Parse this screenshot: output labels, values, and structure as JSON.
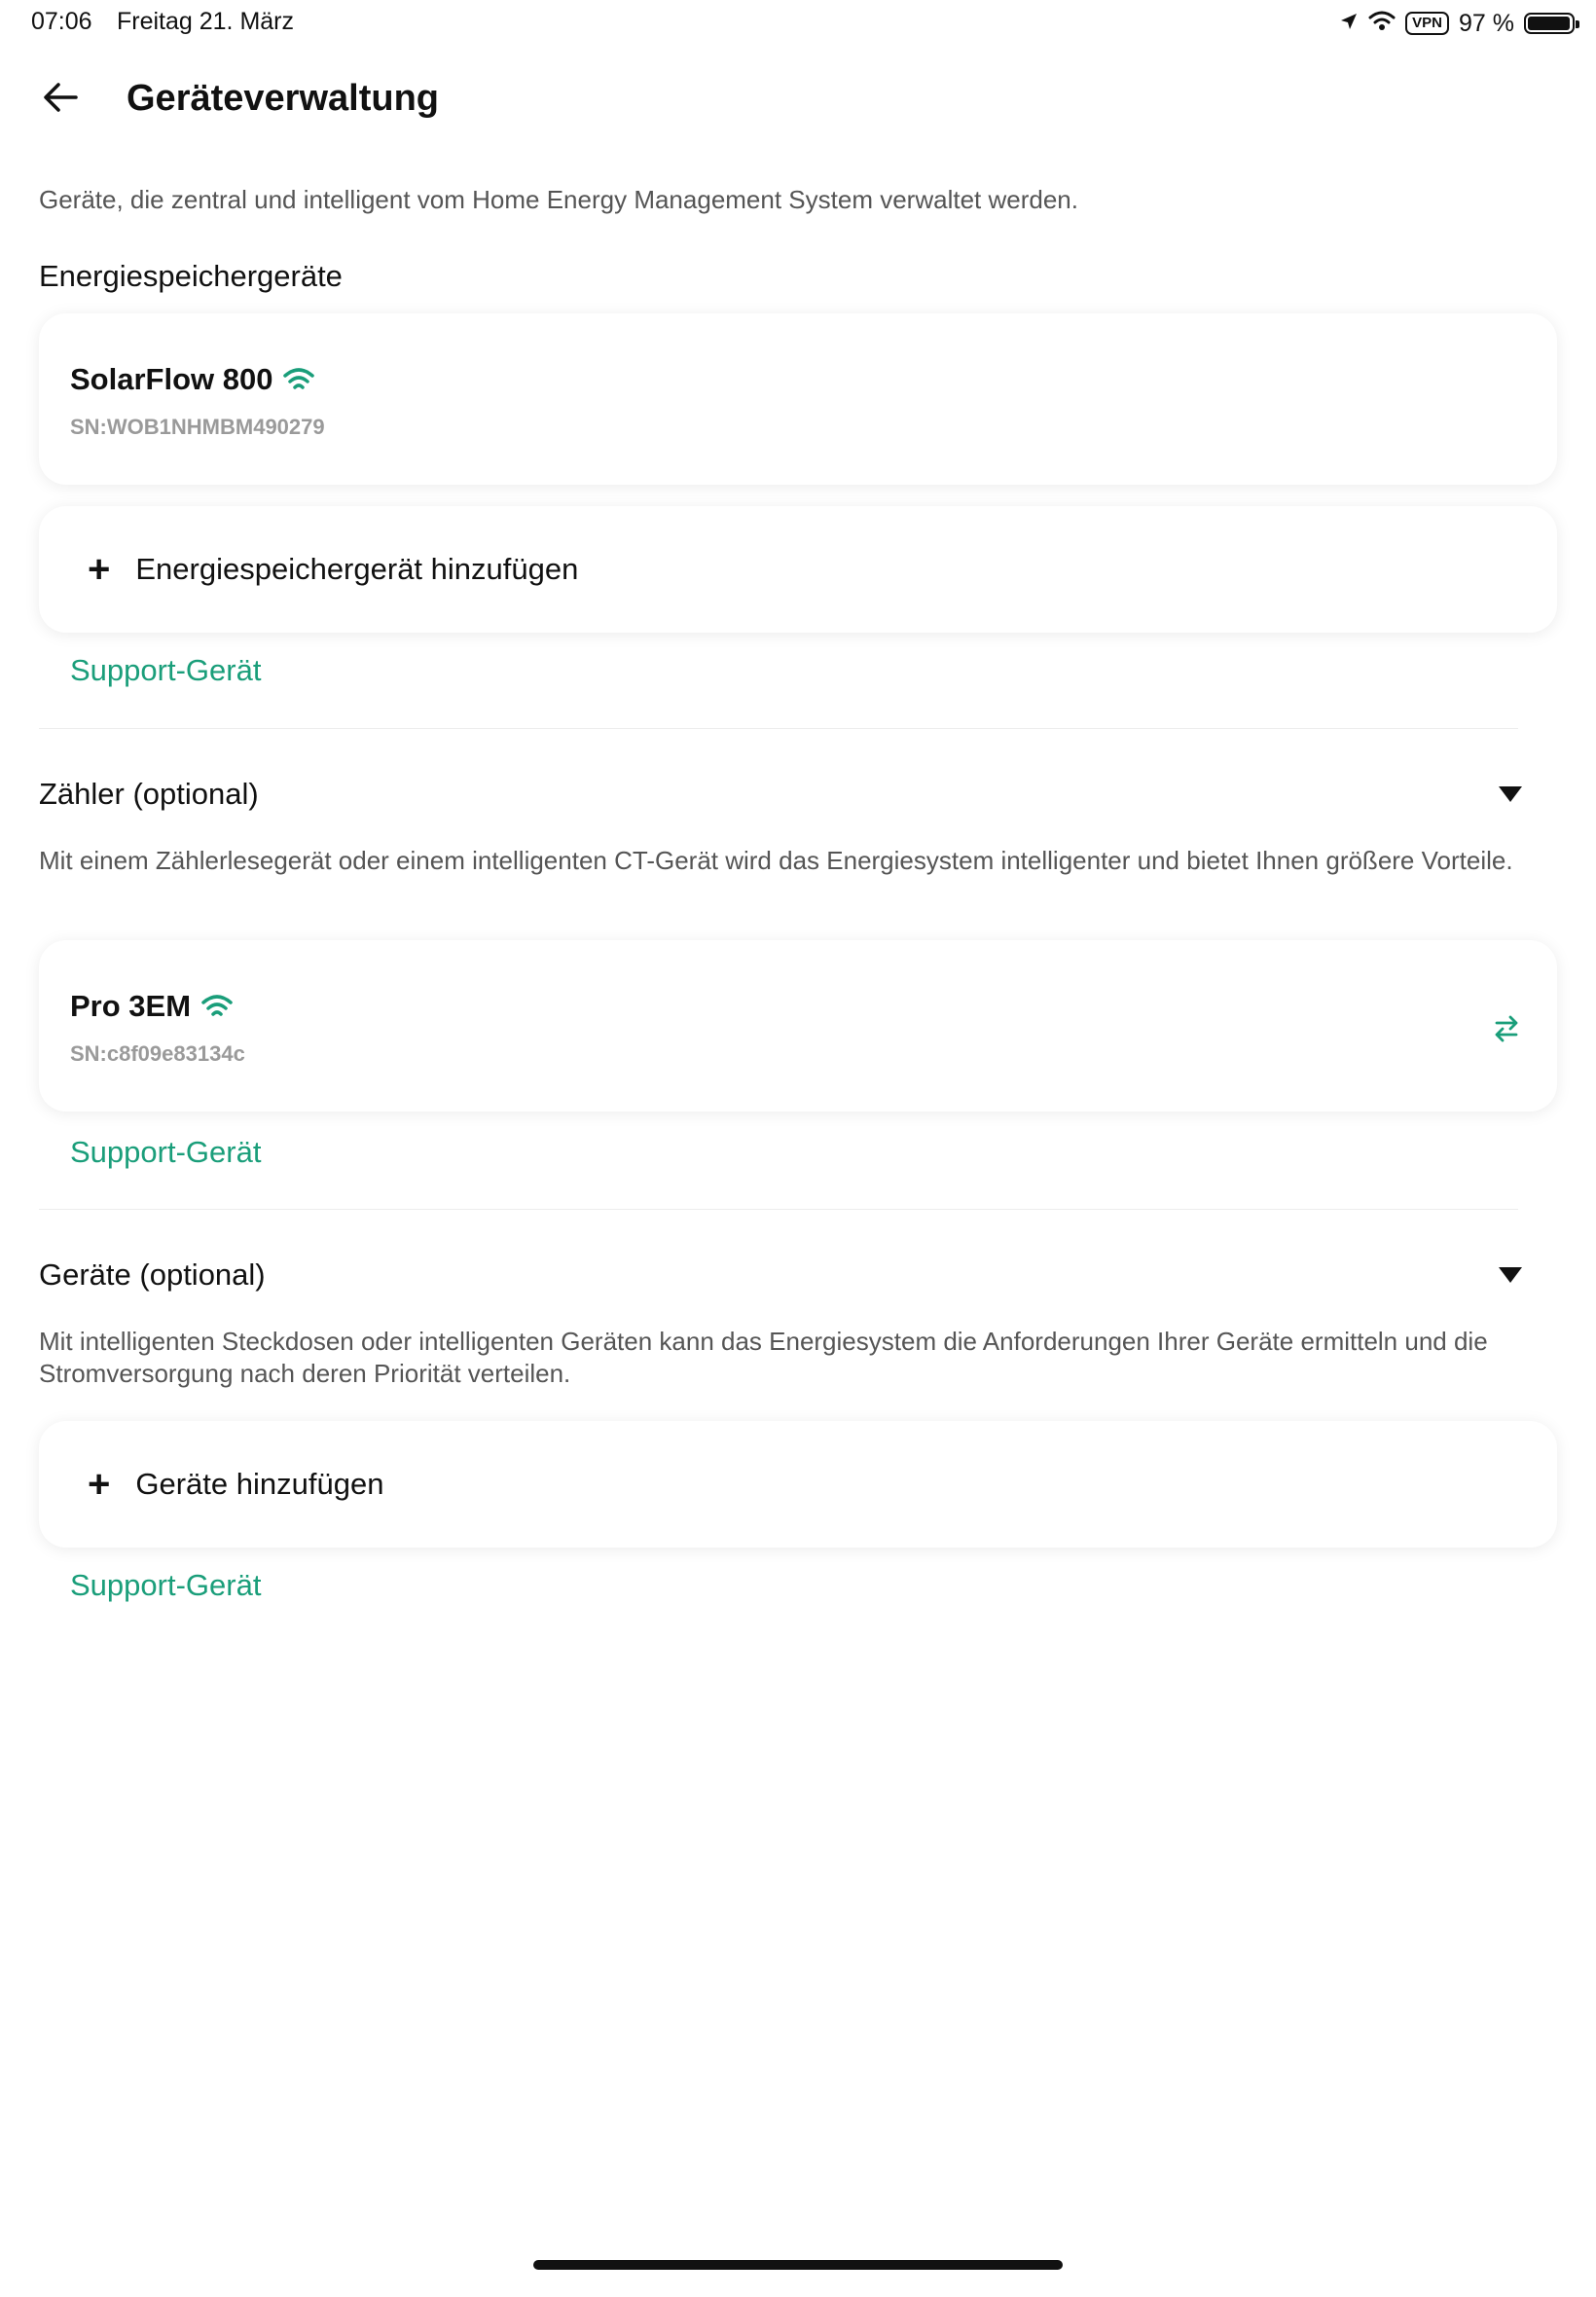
{
  "status_bar": {
    "time": "07:06",
    "date": "Freitag 21. März",
    "vpn": "VPN",
    "battery": "97 %",
    "battery_level": 0.97
  },
  "header": {
    "title": "Geräteverwaltung"
  },
  "intro": "Geräte, die zentral und intelligent vom Home Energy Management System verwaltet werden.",
  "storage": {
    "title": "Energiespeichergeräte",
    "device": {
      "name": "SolarFlow 800",
      "sn": "SN:WOB1NHMBM490279"
    },
    "add_label": "Energiespeichergerät hinzufügen",
    "support": "Support-Gerät"
  },
  "meter": {
    "title": "Zähler (optional)",
    "description": "Mit einem Zählerlesegerät oder einem intelligenten CT-Gerät wird das Energiesystem intelligenter und bietet Ihnen größere Vorteile.",
    "device": {
      "name": "Pro 3EM",
      "sn": "SN:c8f09e83134c"
    },
    "support": "Support-Gerät"
  },
  "appliances": {
    "title": "Geräte (optional)",
    "description": "Mit intelligenten Steckdosen oder intelligenten Geräten kann das Energiesystem die Anforderungen Ihrer Geräte ermitteln und die Stromversorgung nach deren Priorität verteilen.",
    "add_label": "Geräte hinzufügen",
    "support": "Support-Gerät"
  },
  "colors": {
    "accent": "#1a9e7a",
    "text": "#111111",
    "muted": "#555555",
    "sn": "#9a9a9a"
  }
}
